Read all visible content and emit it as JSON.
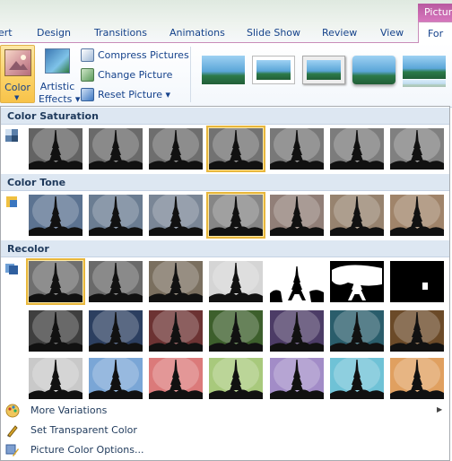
{
  "tabs": [
    "ert",
    "Design",
    "Transitions",
    "Animations",
    "Slide Show",
    "Review",
    "View"
  ],
  "context": {
    "header": "Picture",
    "tab": "For"
  },
  "ribbon": {
    "color_label": "Color",
    "artistic_label": "Artistic",
    "artistic_label2": "Effects",
    "compress": "Compress Pictures",
    "change": "Change Picture",
    "reset": "Reset Picture"
  },
  "sections": {
    "saturation": "Color Saturation",
    "tone": "Color Tone",
    "recolor": "Recolor"
  },
  "menu": {
    "more": "More Variations",
    "transparent": "Set Transparent Color",
    "options": "Picture Color Options..."
  },
  "colors": {
    "selection": "#e8b73d",
    "saturation": [
      "#636363",
      "#6a6a6a",
      "#6e6e6e",
      "#727272",
      "#787878",
      "#7c7c7c",
      "#808080"
    ],
    "tone": [
      "#5c7391",
      "#6b7d92",
      "#7a8696",
      "#868686",
      "#917f78",
      "#97836f",
      "#a0846a"
    ],
    "recolor_row1": [
      "#6f6f6f",
      "#6a6a6a",
      "#7a6f5f",
      "#d5d5d5",
      "bw-light",
      "bw-dark",
      "bw-black"
    ],
    "recolor_row2": [
      "#3f3f3f",
      "#2c3f60",
      "#6c3333",
      "#3d5f2c",
      "#4c3c66",
      "#2a5d6b",
      "#6b4a28"
    ],
    "recolor_row3": [
      "#c9c9c9",
      "#7aa6d6",
      "#db7a7a",
      "#a8c97c",
      "#a28cc7",
      "#6fc2d6",
      "#e0a060"
    ]
  }
}
